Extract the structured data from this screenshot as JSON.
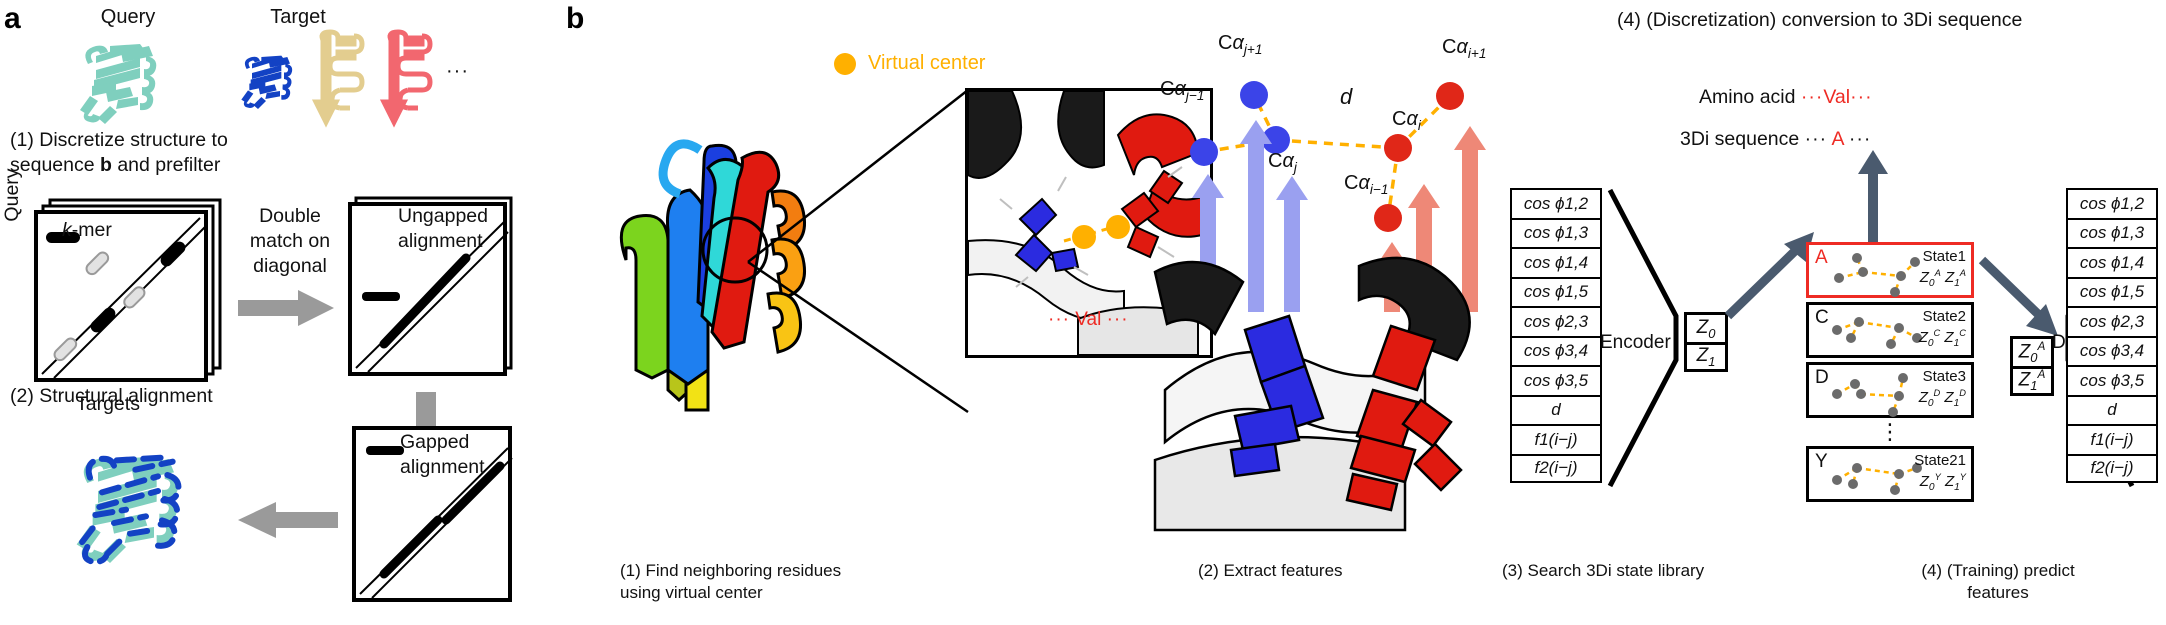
{
  "figure": {
    "panel_a_letter": "a",
    "panel_b_letter": "b"
  },
  "panel_a": {
    "query_label": "Query",
    "target_label": "Target",
    "target_ellipsis": "···",
    "step1": "(1) Discretize structure to\nsequence b and prefilter",
    "step1_line1_pre": "(1) Discretize structure to",
    "step1_line2_pre": "sequence ",
    "step1_line2_bold": "b",
    "step1_line2_post": " and prefilter",
    "step2": "(2) Structural alignment",
    "matrix_axis_y": "Query",
    "matrix_axis_x": "Targets",
    "legend_kmer_italic": "k",
    "legend_kmer_rest": "-mer",
    "arrow1_label": "Double\nmatch on\ndiagonal",
    "arrow1_line1": "Double",
    "arrow1_line2": "match on",
    "arrow1_line3": "diagonal",
    "ungapped_line1": "Ungapped",
    "ungapped_line2": "alignment",
    "gapped_line1": "Gapped",
    "gapped_line2": "alignment",
    "colors": {
      "query_teal": "#7FCFBE",
      "target_blue": "#1342C4",
      "target_tan": "#E3CD8F",
      "target_red": "#F2676F",
      "arrow_gray": "#9A9A9A"
    }
  },
  "panel_b": {
    "step_top": "(4) (Discretization) conversion to 3Di sequence",
    "amino_acid_label": "Amino acid",
    "amino_acid_dots_left": "···",
    "amino_acid_value": "Val",
    "amino_acid_dots_right": "···",
    "three_di_label": "3Di sequence",
    "three_di_dots_left": "···",
    "three_di_value": "A",
    "three_di_dots_right": "···",
    "virtual_center_legend": "Virtual center",
    "val_inset_label": "Val",
    "val_inset_dots_left": "···",
    "val_inset_dots_right": "···",
    "distance_label": "d",
    "ca_labels": {
      "j_minus_1": "Cαj−1",
      "j_plus_1": "Cαj+1",
      "j": "Cαj",
      "i_minus_1": "Cαi−1",
      "i": "Cαi",
      "i_plus_1": "Cαi+1"
    },
    "encoder_label": "Encoder",
    "decoder_label": "Decoder",
    "features": [
      "cos ϕ1,2",
      "cos ϕ1,3",
      "cos ϕ1,4",
      "cos ϕ1,5",
      "cos ϕ2,3",
      "cos ϕ3,4",
      "cos ϕ3,5",
      "d",
      "f1(i−j)",
      "f2(i−j)"
    ],
    "latent_in": [
      "Z0",
      "Z1"
    ],
    "latent_out": [
      "Z0A",
      "Z1A"
    ],
    "states": [
      {
        "letter": "A",
        "name": "State1",
        "z0": "Z0A",
        "z1": "Z1A",
        "selected": true
      },
      {
        "letter": "C",
        "name": "State2",
        "z0": "Z0C",
        "z1": "Z1C",
        "selected": false
      },
      {
        "letter": "D",
        "name": "State3",
        "z0": "Z0D",
        "z1": "Z1D",
        "selected": false
      },
      {
        "letter": "Y",
        "name": "State21",
        "z0": "Z0Y",
        "z1": "Z1Y",
        "selected": false
      }
    ],
    "state_vertical_ellipsis": "⋮",
    "captions": {
      "c1_line1": "(1) Find neighboring residues",
      "c1_line2": "using virtual center",
      "c2": "(2) Extract features",
      "c3": "(3) Search 3Di state library",
      "c4_line1": "(4) (Training) predict",
      "c4_line2": "features"
    },
    "colors": {
      "orange": "#FFB000",
      "red": "#EE2B24",
      "blue_res": "#3B44E8",
      "red_res": "#E02718",
      "arrow_blue": "#9AA0F0",
      "arrow_red": "#EE8877",
      "steel": "#4A5A6E"
    }
  }
}
